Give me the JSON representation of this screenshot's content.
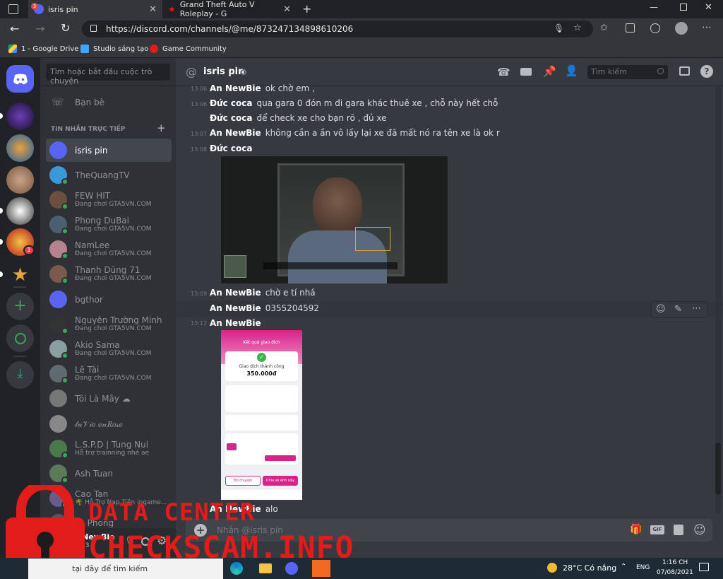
{
  "browser": {
    "tabs": [
      {
        "title": "isris pin",
        "badge": "3"
      },
      {
        "title": "Grand Theft Auto V Roleplay - G"
      }
    ],
    "url": "https://discord.com/channels/@me/873247134898610206",
    "bookmarks": [
      "1 - Google Drive",
      "Studio sáng tạo",
      "Game Community"
    ]
  },
  "servers": {
    "badge": "1"
  },
  "dm": {
    "search_placeholder": "Tìm hoặc bắt đầu cuộc trò chuyện",
    "friends": "Bạn bè",
    "section": "TIN NHẮN TRỰC TIẾP",
    "items": [
      {
        "name": "isris pin",
        "sub": ""
      },
      {
        "name": "TheQuangTV",
        "sub": ""
      },
      {
        "name": "FEW HIT",
        "sub": "Đang chơi GTA5VN.COM"
      },
      {
        "name": "Phong DuBai",
        "sub": "Đang chơi GTA5VN.COM"
      },
      {
        "name": "NamLee",
        "sub": "Đang chơi GTA5VN.COM"
      },
      {
        "name": "Thanh Dũng 71",
        "sub": "Đang chơi GTA5VN.COM"
      },
      {
        "name": "bgthor",
        "sub": ""
      },
      {
        "name": "Nguyễn Trường Minh",
        "sub": "Đang chơi GTA5VN.COM"
      },
      {
        "name": "Akio Sama",
        "sub": "Đang chơi GTA5VN.COM"
      },
      {
        "name": "Lê Tài",
        "sub": "Đang chơi GTA5VN.COM"
      },
      {
        "name": "Tôi Là Mây ☁",
        "sub": ""
      },
      {
        "name": "𝓁𝒶𝒱𝒾𝑒 𝑒𝓃𝑅𝑜𝓈𝑒",
        "sub": ""
      },
      {
        "name": "L.S.P.D | Tung Nui",
        "sub": "Hỗ trợ trainning nhé ae"
      },
      {
        "name": "Ash Tuan",
        "sub": ""
      },
      {
        "name": "Cao Tan",
        "sub": "🌴 Hỗ Trợ Nạp Tiền ingame..."
      },
      {
        "name": "Le Phong",
        "sub": ""
      }
    ]
  },
  "user": {
    "name": "An NewBie",
    "tag": "#2713"
  },
  "chat": {
    "channel": "isris pin",
    "search_placeholder": "Tìm kiếm",
    "messages": [
      {
        "time": "13:06",
        "author": "An NewBie",
        "text": "ok chờ em ,"
      },
      {
        "time": "13:06",
        "author": "Đức coca",
        "text": "qua gara 0 đón m đi gara khác thuê xe , chỗ này hết chỗ"
      },
      {
        "time": "",
        "author": "Đức coca",
        "text": "để check xe cho bạn rõ , đủ xe"
      },
      {
        "time": "13:07",
        "author": "An NewBie",
        "text": "không cần a ần vô lấy lại xe đã mất nó ra tên xe là ok r"
      },
      {
        "time": "13:08",
        "author": "Đức coca",
        "text": ""
      },
      {
        "time": "13:09",
        "author": "An NewBie",
        "text": "chờ e tí nhá"
      },
      {
        "time": "",
        "author": "An NewBie",
        "text": "0355204592"
      },
      {
        "time": "13:12",
        "author": "An NewBie",
        "text": ""
      },
      {
        "time": "",
        "author": "An NewBie",
        "text": "alo"
      }
    ],
    "input_placeholder": "Nhắn @isris pin"
  },
  "receipt": {
    "header": "Kết quả giao dịch",
    "status": "Giao dịch thành công",
    "amount": "350.000đ",
    "btn_left": "Trò chuyện",
    "btn_right": "Chia sẻ ảnh này"
  },
  "watermark": {
    "line1": "DATA CENTER",
    "line2": "CHECKSCAM.INFO"
  },
  "taskbar": {
    "search": "tại đây để tìm kiếm",
    "weather": "28°C  Có nắng",
    "lang": "ENG",
    "time": "1:16 CH",
    "date": "07/08/2021"
  },
  "colors": {
    "blurple": "#5865f2",
    "online": "#3ba55d",
    "watermark": "#e21b1b"
  }
}
